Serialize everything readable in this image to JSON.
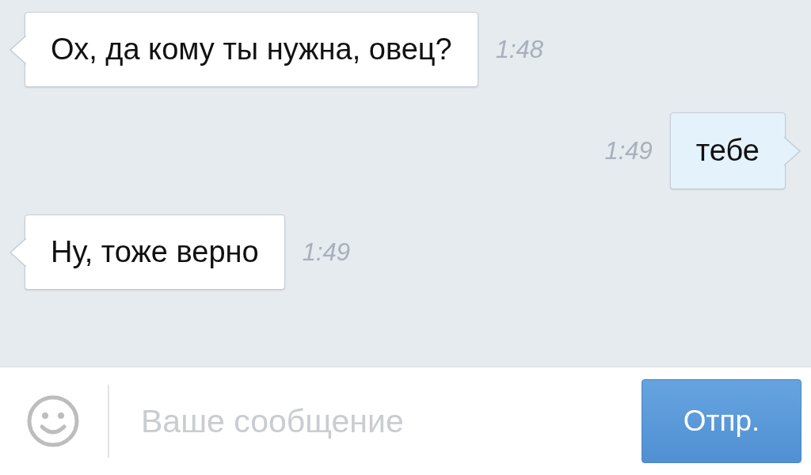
{
  "messages": [
    {
      "kind": "incoming",
      "text": "Ох, да кому ты нужна, овец?",
      "time": "1:48"
    },
    {
      "kind": "outgoing",
      "text": "тебе",
      "time": "1:49"
    },
    {
      "kind": "incoming",
      "text": "Ну, тоже верно",
      "time": "1:49"
    }
  ],
  "composer": {
    "placeholder": "Ваше сообщение"
  },
  "send_button": {
    "label": "Отпр."
  }
}
